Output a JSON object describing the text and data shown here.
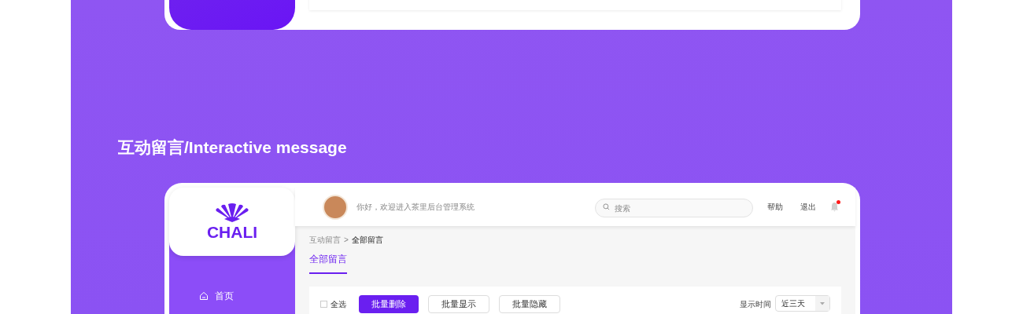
{
  "section_title": "互动留言/Interactive message",
  "logo": {
    "text": "CHALI"
  },
  "header": {
    "greeting": "你好，欢迎进入茶里后台管理系统",
    "search": {
      "placeholder": "搜索"
    },
    "links": [
      "帮助",
      "退出"
    ],
    "notification": {
      "unread": true
    }
  },
  "breadcrumb": [
    "互动留言",
    "全部留言"
  ],
  "breadcrumb_separator": ">",
  "page_tabs": [
    {
      "label": "全部留言",
      "selected": true
    }
  ],
  "toolbar": {
    "select_all": {
      "label": "全选",
      "checked": false
    },
    "buttons": [
      {
        "label": "批量删除",
        "kind": "primary"
      },
      {
        "label": "批量显示",
        "kind": "outline"
      },
      {
        "label": "批量隐藏",
        "kind": "outline"
      }
    ],
    "time_filter": {
      "label": "显示时间",
      "value": "近三天"
    }
  },
  "sidebar": {
    "items": [
      {
        "label": "首页",
        "selected": false
      }
    ]
  }
}
